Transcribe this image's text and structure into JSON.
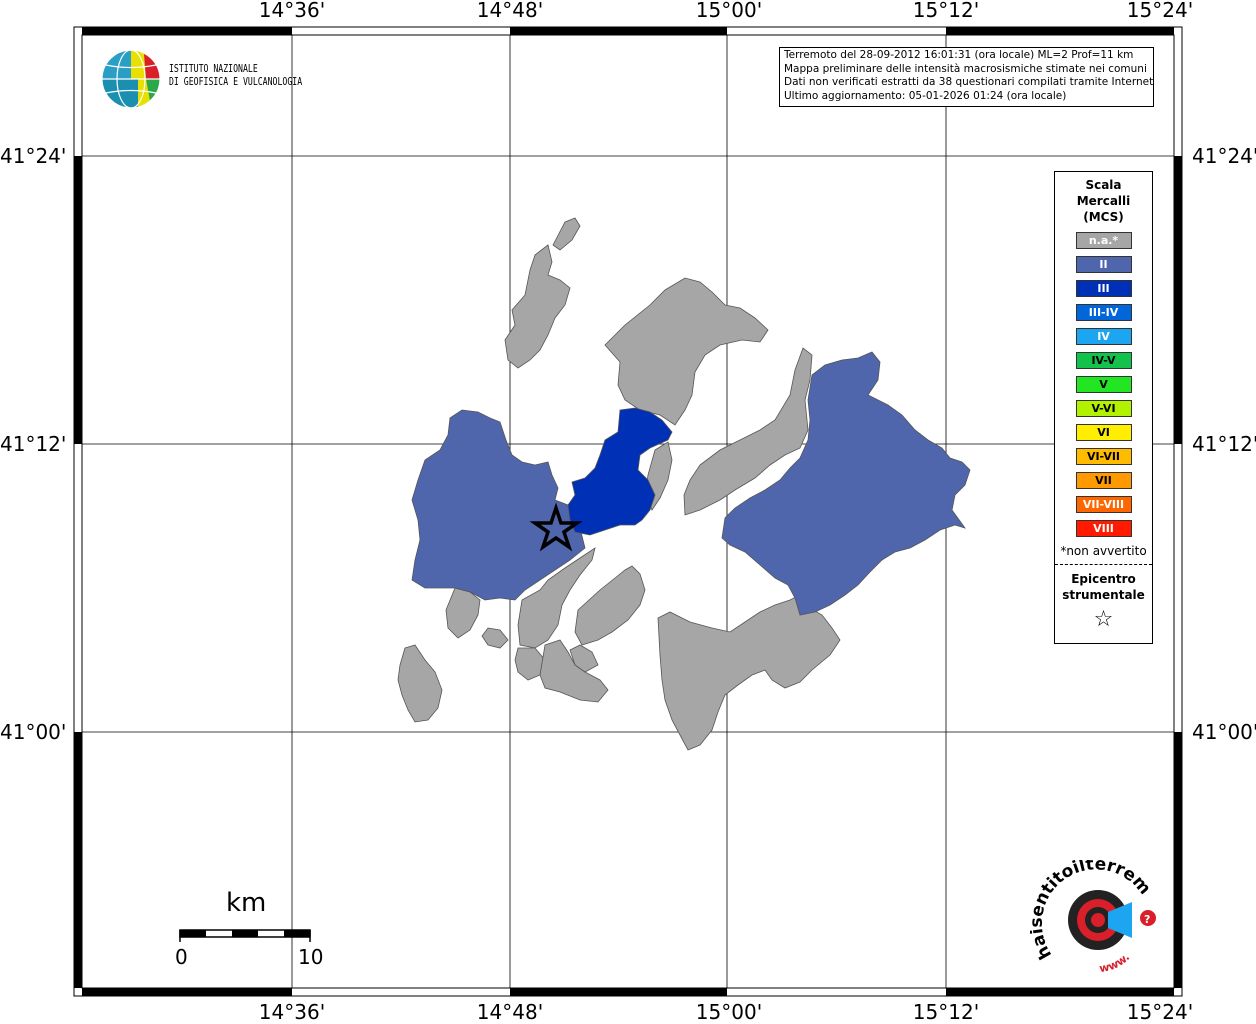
{
  "map": {
    "lon_labels": [
      "14°36'",
      "14°48'",
      "15°00'",
      "15°12'",
      "15°24'"
    ],
    "lat_labels": [
      "41°24'",
      "41°12'",
      "41°00'"
    ]
  },
  "info": {
    "line1": "Terremoto del 28-09-2012 16:01:31 (ora locale) ML=2 Prof=11 km",
    "line2": "Mappa preliminare delle intensità macrosismiche stimate nei comuni",
    "line3": "Dati non verificati estratti da 38 questionari compilati tramite Internet.",
    "line4": "Ultimo aggiornamento: 05-01-2026 01:24 (ora locale)"
  },
  "logo": {
    "name_line1": "ISTITUTO NAZIONALE",
    "name_line2": "DI GEOFISICA E VULCANOLOGIA"
  },
  "legend": {
    "title_line1": "Scala",
    "title_line2": "Mercalli",
    "title_line3": "(MCS)",
    "classes": [
      {
        "label": "n.a.*",
        "color": "#a6a6a6",
        "text": "#ffffff"
      },
      {
        "label": "II",
        "color": "#4f66ad",
        "text": "#ffffff"
      },
      {
        "label": "III",
        "color": "#0030b5",
        "text": "#ffffff"
      },
      {
        "label": "III-IV",
        "color": "#0066d9",
        "text": "#ffffff"
      },
      {
        "label": "IV",
        "color": "#1ca6f2",
        "text": "#ffffff"
      },
      {
        "label": "IV-V",
        "color": "#12c24a",
        "text": "#000000"
      },
      {
        "label": "V",
        "color": "#22e622",
        "text": "#000000"
      },
      {
        "label": "V-VI",
        "color": "#b2f200",
        "text": "#000000"
      },
      {
        "label": "VI",
        "color": "#ffee00",
        "text": "#000000"
      },
      {
        "label": "VI-VII",
        "color": "#ffbb00",
        "text": "#000000"
      },
      {
        "label": "VII",
        "color": "#ff9900",
        "text": "#000000"
      },
      {
        "label": "VII-VIII",
        "color": "#ff6600",
        "text": "#ffffff"
      },
      {
        "label": "VIII",
        "color": "#ff1a00",
        "text": "#ffffff"
      }
    ],
    "note": "*non avvertito",
    "epicenter_line1": "Epicentro",
    "epicenter_line2": "strumentale",
    "epicenter_symbol": "☆"
  },
  "scale": {
    "unit": "km",
    "min_label": "0",
    "max_label": "10"
  },
  "municipalities": [
    {
      "name": "municipality-west",
      "intensity": "II"
    },
    {
      "name": "municipality-center",
      "intensity": "III"
    },
    {
      "name": "municipality-east",
      "intensity": "II"
    },
    {
      "name": "municipality-others",
      "intensity": "n.a.*"
    }
  ],
  "watermark": {
    "text": "haisentitoilterremoto.it",
    "url_text": "www."
  }
}
